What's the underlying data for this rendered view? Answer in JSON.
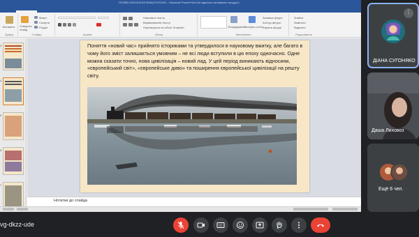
{
  "window": {
    "title": "ПОЯВА КЛАСИЧНОЇ ВИЩОЇ ЕПОХИ – Microsoft PowerPoint (Не вдалося активувати продукт)"
  },
  "ribbon_tabs": [
    "Файл",
    "Основне",
    "Вставлення",
    "Переходи",
    "Анімація",
    "Показ слайдів",
    "Рецензування",
    "Вигляд"
  ],
  "ribbon": {
    "paste_label": "Вставити",
    "new_slide_label": "Створити слайд",
    "layout_label": "Макет",
    "reset_label": "Скинути",
    "section_label": "Розділ",
    "group_clipboard": "Буфер",
    "group_slides": "Слайди",
    "group_font": "Шрифт",
    "group_paragraph": "Абзац",
    "group_drawing": "Малювання",
    "group_editing": "Редагування",
    "find_label": "Знайти",
    "replace_label": "Замінити",
    "select_label": "Виділити",
    "text_direction": "Напрямок тексту",
    "align_text": "Вирівнювання тексту",
    "convert_smartart": "Перетворити на об'єкт SmartArt",
    "arrange_label": "Упорядкувати",
    "quick_styles": "Експрес-стилі",
    "fill_label": "Заливка фігури",
    "outline_label": "Контур фігури",
    "effects_label": "Ефекти фігури"
  },
  "slide": {
    "text": "Поняття «новий час» прийнято істориками та утвердилося в науковому вжитку, але багато в чому його зміст залишається умовним – не всі люди вступили в цю епоху одночасно. Одне можна сказати точно, нова цивілізація – новий лад. У цей період виникають відносини, «європейський світ», «європейське диво» та поширення європейської цивілізації на решту світу."
  },
  "thumbnails": [
    {
      "num": "3",
      "selected": false
    },
    {
      "num": "4",
      "selected": true
    },
    {
      "num": "5",
      "selected": false
    },
    {
      "num": "6",
      "selected": false
    },
    {
      "num": "7",
      "selected": false
    }
  ],
  "notes": {
    "placeholder": "Нотатки до слайда"
  },
  "participants": [
    {
      "name": "ДІАНА СУГОНЯКО"
    },
    {
      "name": "Даша Лиховоз"
    },
    {
      "name": "Ещё 6 чел."
    }
  ],
  "meeting": {
    "code": "vg-dkzz-ude"
  },
  "controls": [
    "mic-off",
    "camera",
    "captions",
    "emoji",
    "present",
    "raise-hand",
    "more",
    "leave-call"
  ],
  "colors": {
    "accent": "#2b579a",
    "end_call": "#ea4335",
    "slide_bg": "#f8e7c6",
    "highlight": "#8ab4f8"
  }
}
